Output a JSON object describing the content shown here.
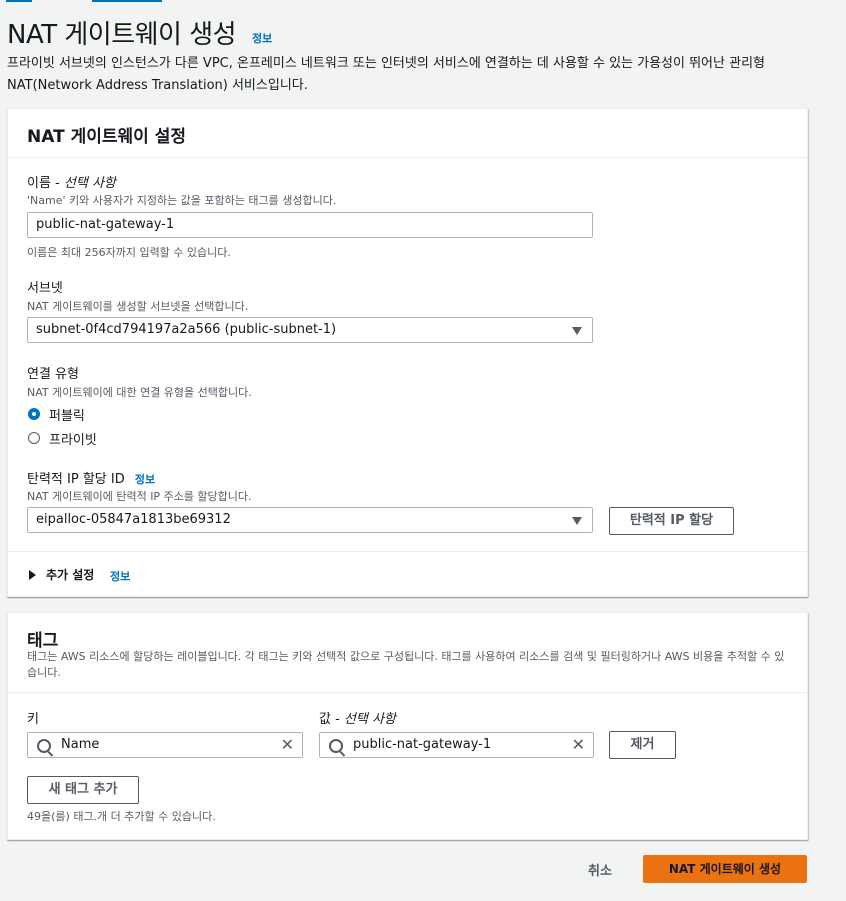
{
  "page": {
    "title": "NAT 게이트웨이 생성",
    "info": "정보",
    "description": "프라이빗 서브넷의 인스턴스가 다른 VPC, 온프레미스 네트워크 또는 인터넷의 서비스에 연결하는 데 사용할 수 있는 가용성이 뛰어난 관리형 NAT(Network Address Translation) 서비스입니다."
  },
  "settings": {
    "title": "NAT 게이트웨이 설정",
    "name": {
      "label": "이름 - ",
      "label_optional": "선택 사항",
      "desc": "'Name' 키와 사용자가 지정하는 값을 포함하는 태그를 생성합니다.",
      "value": "public-nat-gateway-1",
      "hint": "이름은 최대 256자까지 입력할 수 있습니다."
    },
    "subnet": {
      "label": "서브넷",
      "desc": "NAT 게이트웨이를 생성할 서브넷을 선택합니다.",
      "value": "subnet-0f4cd794197a2a566 (public-subnet-1)"
    },
    "connectivity": {
      "label": "연결 유형",
      "desc": "NAT 게이트웨이에 대한 연결 유형을 선택합니다.",
      "options": [
        "퍼블릭",
        "프라이빗"
      ],
      "selected": "퍼블릭"
    },
    "eip": {
      "label": "탄력적 IP 할당 ID",
      "info": "정보",
      "desc": "NAT 게이트웨이에 탄력적 IP 주소를 할당합니다.",
      "value": "eipalloc-05847a1813be69312",
      "button": "탄력적 IP 할당"
    },
    "additional": {
      "label": "추가 설정",
      "info": "정보"
    }
  },
  "tags": {
    "title": "태그",
    "description": "태그는 AWS 리소스에 할당하는 레이블입니다. 각 태그는 키와 선택적 값으로 구성됩니다. 태그를 사용하여 리소스를 검색 및 필터링하거나 AWS 비용을 추적할 수 있습니다.",
    "key_label": "키",
    "value_label": "값 - ",
    "value_label_optional": "선택 사항",
    "key_value": "Name",
    "value_value": "public-nat-gateway-1",
    "remove_button": "제거",
    "add_button": "새 태그 추가",
    "remaining": "49을(를) 태그.개 더 추가할 수 있습니다."
  },
  "footer": {
    "cancel": "취소",
    "submit": "NAT 게이트웨이 생성"
  },
  "colors": {
    "link": "#0073bb",
    "primary": "#ec7211",
    "border": "#aab7b8"
  }
}
